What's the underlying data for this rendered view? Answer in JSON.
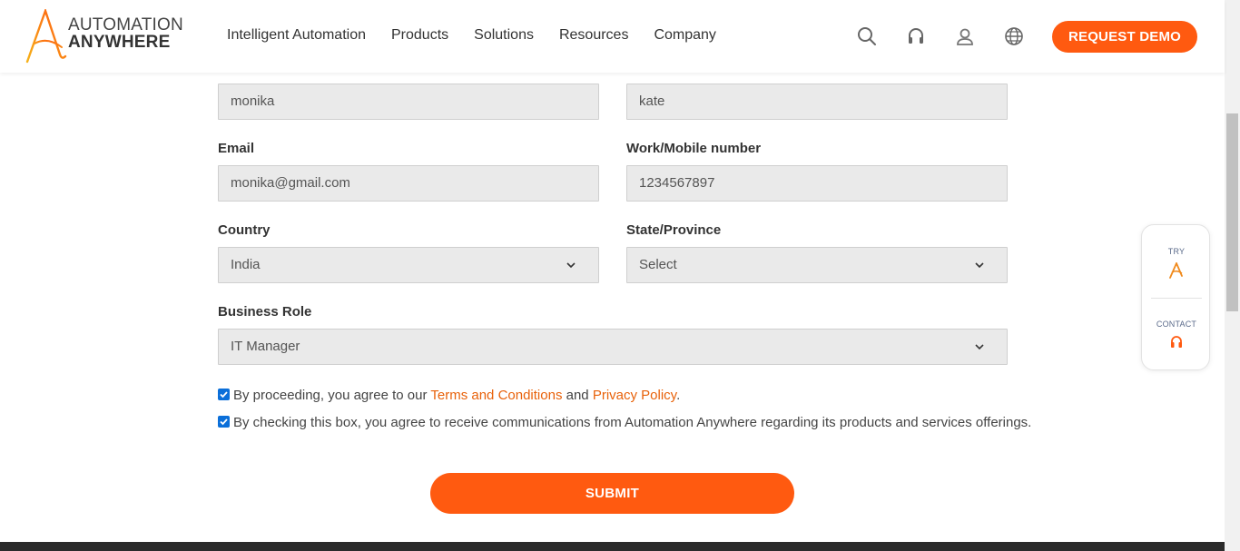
{
  "header": {
    "logo": {
      "line1": "AUTOMATION",
      "line2": "ANYWHERE"
    },
    "nav": [
      "Intelligent Automation",
      "Products",
      "Solutions",
      "Resources",
      "Company"
    ],
    "icons": [
      "search-icon",
      "headset-icon",
      "user-icon",
      "globe-icon"
    ],
    "demo_label": "REQUEST DEMO"
  },
  "form": {
    "first_name": {
      "value": "monika"
    },
    "last_name": {
      "value": "kate"
    },
    "email": {
      "label": "Email",
      "value": "monika@gmail.com"
    },
    "phone": {
      "label": "Work/Mobile number",
      "value": "1234567897"
    },
    "country": {
      "label": "Country",
      "value": "India"
    },
    "state": {
      "label": "State/Province",
      "value": "Select"
    },
    "role": {
      "label": "Business Role",
      "value": "IT Manager"
    },
    "consent1": {
      "prefix": "By proceeding, you agree to our ",
      "terms": "Terms and Conditions",
      "mid": " and ",
      "privacy": "Privacy Policy",
      "suffix": ".",
      "checked": true
    },
    "consent2": {
      "text": "By checking this box, you agree to receive communications from Automation Anywhere regarding its products and services offerings.",
      "checked": true
    },
    "submit_label": "SUBMIT"
  },
  "widget": {
    "try_label": "TRY",
    "contact_label": "CONTACT"
  },
  "colors": {
    "accent": "#ff5a10",
    "link": "#e8620b",
    "field_bg": "#eaeaea",
    "checkbox": "#0b6fd9"
  }
}
